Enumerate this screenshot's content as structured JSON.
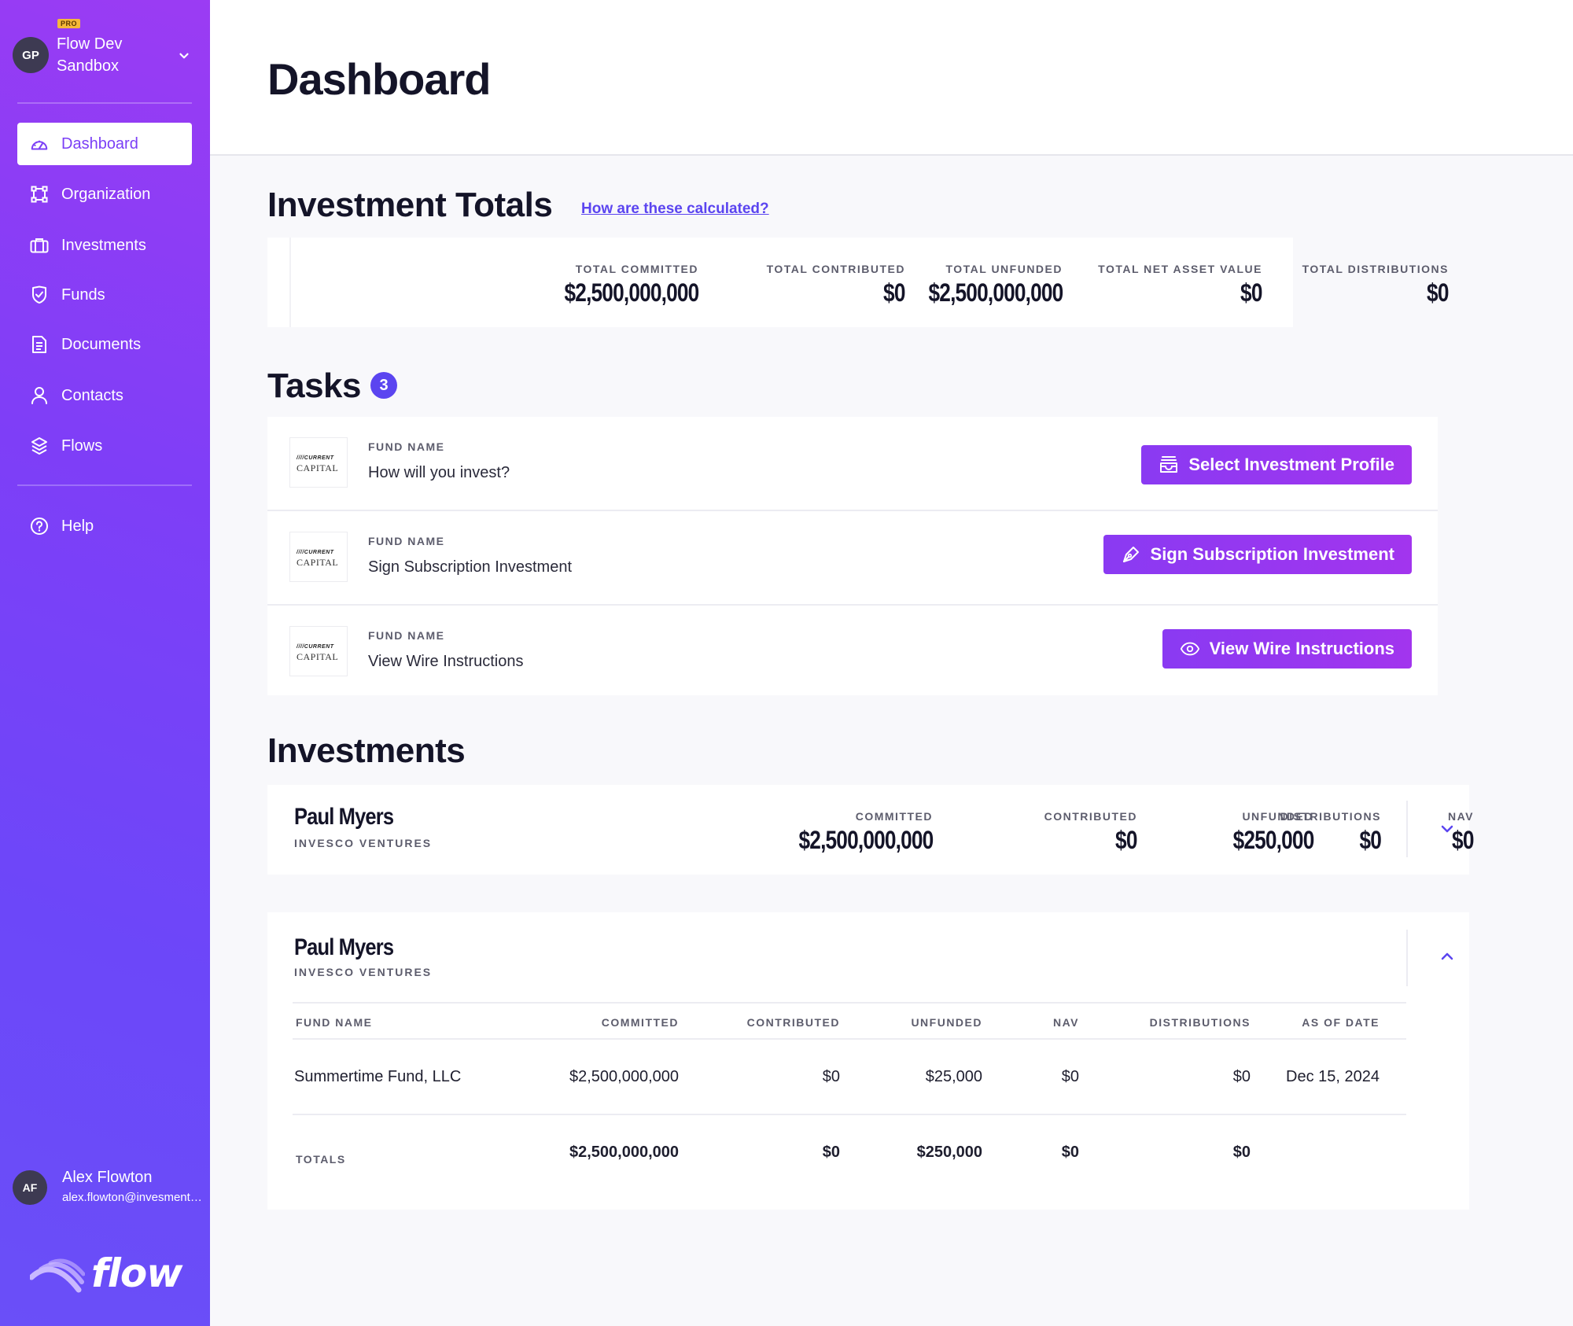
{
  "org": {
    "badge": "PRO",
    "initials": "GP",
    "name": "Flow Dev Sandbox"
  },
  "nav": [
    {
      "label": "Dashboard",
      "icon": "gauge-icon"
    },
    {
      "label": "Organization",
      "icon": "nodes-icon"
    },
    {
      "label": "Investments",
      "icon": "briefcase-icon"
    },
    {
      "label": "Funds",
      "icon": "shield-check-icon"
    },
    {
      "label": "Documents",
      "icon": "document-icon"
    },
    {
      "label": "Contacts",
      "icon": "user-icon"
    },
    {
      "label": "Flows",
      "icon": "layers-icon"
    }
  ],
  "help": {
    "label": "Help"
  },
  "user": {
    "initials": "AF",
    "name": "Alex Flowton",
    "email": "alex.flowton@invesmentflow.com"
  },
  "brand": {
    "wordmark": "flow"
  },
  "page": {
    "title": "Dashboard"
  },
  "totals": {
    "title": "Investment Totals",
    "link": "How are these calculated?",
    "items": [
      {
        "label": "TOTAL COMMITTED",
        "value": "$2,500,000,000"
      },
      {
        "label": "TOTAL CONTRIBUTED",
        "value": "$0"
      },
      {
        "label": "TOTAL UNFUNDED",
        "value": "$2,500,000,000"
      },
      {
        "label": "TOTAL NET ASSET VALUE",
        "value": "$0"
      },
      {
        "label": "TOTAL DISTRIBUTIONS",
        "value": "$0"
      }
    ]
  },
  "tasks": {
    "title": "Tasks",
    "count": "3",
    "logo": {
      "line1": "////CURRENT",
      "line2": "CAPITAL"
    },
    "items": [
      {
        "label": "FUND NAME",
        "text": "How will you invest?",
        "button": "Select Investment Profile"
      },
      {
        "label": "FUND NAME",
        "text": "Sign Subscription Investment",
        "button": "Sign Subscription Investment"
      },
      {
        "label": "FUND NAME",
        "text": "View Wire Instructions",
        "button": "View Wire Instructions"
      }
    ]
  },
  "investments": {
    "title": "Investments",
    "summary": {
      "name": "Paul Myers",
      "sub": "INVESCO VENTURES",
      "cols": [
        {
          "label": "COMMITTED",
          "value": "$2,500,000,000"
        },
        {
          "label": "CONTRIBUTED",
          "value": "$0"
        },
        {
          "label": "UNFUNDED",
          "value": "$250,000"
        },
        {
          "label": "NAV",
          "value": "$0"
        },
        {
          "label": "DISTRIBUTIONS",
          "value": "$0"
        }
      ]
    },
    "detail": {
      "name": "Paul Myers",
      "sub": "INVESCO VENTURES",
      "headers": [
        "FUND NAME",
        "COMMITTED",
        "CONTRIBUTED",
        "UNFUNDED",
        "NAV",
        "DISTRIBUTIONS",
        "AS OF DATE"
      ],
      "row": [
        "Summertime Fund, LLC",
        "$2,500,000,000",
        "$0",
        "$25,000",
        "$0",
        "$0",
        "Dec 15, 2024"
      ],
      "totals_label": "TOTALS",
      "totals": [
        "$2,500,000,000",
        "$0",
        "$250,000",
        "$0",
        "$0"
      ]
    }
  }
}
